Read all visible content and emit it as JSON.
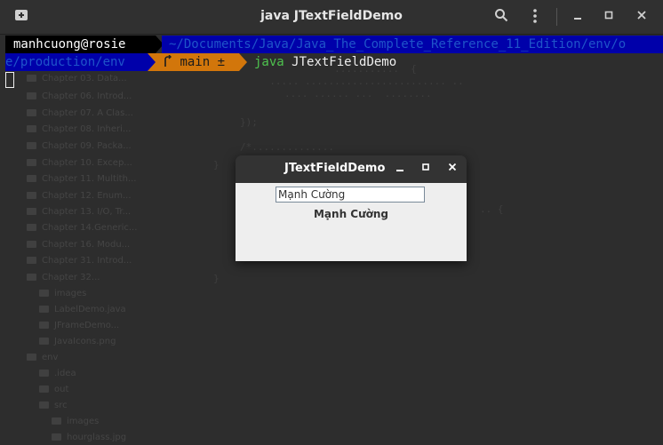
{
  "terminal": {
    "title": "java JTextFieldDemo",
    "icons": {
      "new_tab": "new-tab-icon",
      "search": "search-icon",
      "menu": "kebab-menu-icon",
      "minimize": "minimize-icon",
      "maximize": "maximize-icon",
      "close": "close-icon"
    },
    "prompt": {
      "user_host": "manhcuong@rosie",
      "path_line1": "~/Documents/Java/Java_The_Complete_Reference_11_Edition/env/o",
      "path_line2": "e/production/env",
      "git_branch": "main ±",
      "git_icon": "git-branch-icon",
      "command": "java",
      "argument": "JTextFieldDemo"
    },
    "colors": {
      "user_bg": "#000000",
      "path_bg": "#0000aa",
      "git_bg": "#d2760b",
      "command": "#4ec24e"
    }
  },
  "background_tree": {
    "items": [
      "Chapter 03. Data...",
      "Chapter 06. Introd...",
      "Chapter 07. A Clas...",
      "Chapter 08. Inheri...",
      "Chapter 09. Packa...",
      "Chapter 10. Excep...",
      "Chapter 11. Multith...",
      "Chapter 12. Enum...",
      "Chapter 13. I/O, Tr...",
      "Chapter 14.Generic...",
      "Chapter 16. Modu...",
      "Chapter 31. Introd...",
      "Chapter 32...",
      "images",
      "LabelDemo.java",
      "JFrameDemo...",
      "JavaIcons.png",
      "env",
      ".idea",
      "out",
      "src",
      "images",
      "hourglass.jpg"
    ]
  },
  "swing_window": {
    "title": "JTextFieldDemo",
    "text_field_value": "Mạnh Cường",
    "label_text": "Mạnh Cường"
  }
}
